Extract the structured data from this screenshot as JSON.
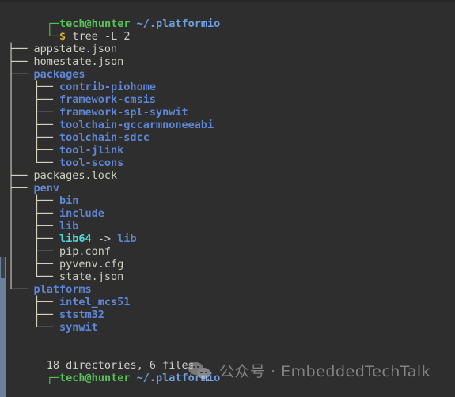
{
  "terminal": {
    "background_color": "#2e2e2e",
    "foreground_color": "#d0cfcc",
    "colors": {
      "directory": "#5f87d7",
      "symlink": "#4fd6d6",
      "file": "#cfcfc2",
      "branch": "#d8d4c4",
      "user": "#57c257",
      "path": "#6c9fe0",
      "prompt_sigil": "#d6b33c"
    }
  },
  "prompt_top": {
    "rule_start": "┌─",
    "user_host": "tech@hunter",
    "space": " ",
    "cwd": "~/.platformio"
  },
  "prompt_command_line": {
    "rule_start": "└─",
    "sigil": "$",
    "command": " tree -L 2"
  },
  "output": {
    "root": ".",
    "lines": [
      {
        "branch": "├── ",
        "name": "appstate.json",
        "kind": "file"
      },
      {
        "branch": "├── ",
        "name": "homestate.json",
        "kind": "file"
      },
      {
        "branch": "├── ",
        "name": "packages",
        "kind": "dir"
      },
      {
        "branch": "│   ├── ",
        "name": "contrib-piohome",
        "kind": "dir"
      },
      {
        "branch": "│   ├── ",
        "name": "framework-cmsis",
        "kind": "dir"
      },
      {
        "branch": "│   ├── ",
        "name": "framework-spl-synwit",
        "kind": "dir"
      },
      {
        "branch": "│   ├── ",
        "name": "toolchain-gccarmnoneeabi",
        "kind": "dir"
      },
      {
        "branch": "│   ├── ",
        "name": "toolchain-sdcc",
        "kind": "dir"
      },
      {
        "branch": "│   ├── ",
        "name": "tool-jlink",
        "kind": "dir"
      },
      {
        "branch": "│   └── ",
        "name": "tool-scons",
        "kind": "dir"
      },
      {
        "branch": "├── ",
        "name": "packages.lock",
        "kind": "file"
      },
      {
        "branch": "├── ",
        "name": "penv",
        "kind": "dir"
      },
      {
        "branch": "│   ├── ",
        "name": "bin",
        "kind": "dir"
      },
      {
        "branch": "│   ├── ",
        "name": "include",
        "kind": "dir"
      },
      {
        "branch": "│   ├── ",
        "name": "lib",
        "kind": "dir"
      },
      {
        "branch": "│   ├── ",
        "name": "lib64",
        "kind": "symlink",
        "arrow": " -> ",
        "target": "lib",
        "target_kind": "dir"
      },
      {
        "branch": "│   ├── ",
        "name": "pip.conf",
        "kind": "file"
      },
      {
        "branch": "│   ├── ",
        "name": "pyvenv.cfg",
        "kind": "file"
      },
      {
        "branch": "│   └── ",
        "name": "state.json",
        "kind": "file"
      },
      {
        "branch": "└── ",
        "name": "platforms",
        "kind": "dir"
      },
      {
        "branch": "    ├── ",
        "name": "intel_mcs51",
        "kind": "dir"
      },
      {
        "branch": "    ├── ",
        "name": "ststm32",
        "kind": "dir"
      },
      {
        "branch": "    └── ",
        "name": "synwit",
        "kind": "dir"
      }
    ],
    "summary": "18 directories, 6 files"
  },
  "prompt_bottom": {
    "rule_start": "┌─",
    "user_host": "tech@hunter",
    "space": " ",
    "cwd": "~/.platformio"
  },
  "watermark": {
    "icon": "wechat-icon",
    "text": "公众号 · EmbeddedTechTalk"
  }
}
